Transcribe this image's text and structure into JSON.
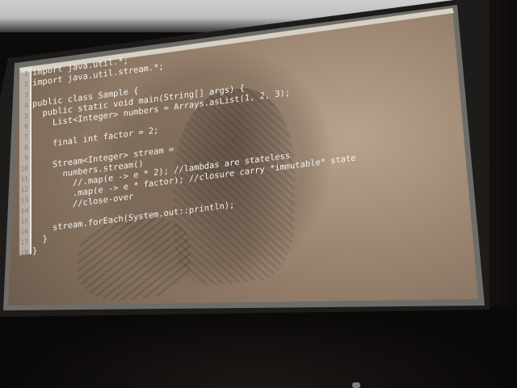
{
  "slide": {
    "code_lines": [
      {
        "n": "1",
        "text": "import java.util.*;"
      },
      {
        "n": "2",
        "text": "import java.util.stream.*;"
      },
      {
        "n": "3",
        "text": ""
      },
      {
        "n": "4",
        "text": "public class Sample {"
      },
      {
        "n": "5",
        "text": "  public static void main(String[] args) {"
      },
      {
        "n": "6",
        "text": "    List<Integer> numbers = Arrays.asList(1, 2, 3);"
      },
      {
        "n": "7",
        "text": ""
      },
      {
        "n": "8",
        "text": "    final int factor = 2;"
      },
      {
        "n": "9",
        "text": ""
      },
      {
        "n": "10",
        "text": "    Stream<Integer> stream ="
      },
      {
        "n": "11",
        "text": "      numbers.stream()"
      },
      {
        "n": "12",
        "text": "        //.map(e -> e * 2); //lambdas are stateless"
      },
      {
        "n": "13",
        "text": "        .map(e -> e * factor); //closure carry *immutable* state"
      },
      {
        "n": "14",
        "text": "        //close-over"
      },
      {
        "n": "15",
        "text": ""
      },
      {
        "n": "16",
        "text": "    stream.forEach(System.out::println);"
      },
      {
        "n": "17",
        "text": "  }"
      },
      {
        "n": "18",
        "text": "}"
      }
    ]
  },
  "colors": {
    "code_text": "#f6f4ef",
    "line_numbers": "#8a7d70",
    "room": "#0d0b0a"
  }
}
